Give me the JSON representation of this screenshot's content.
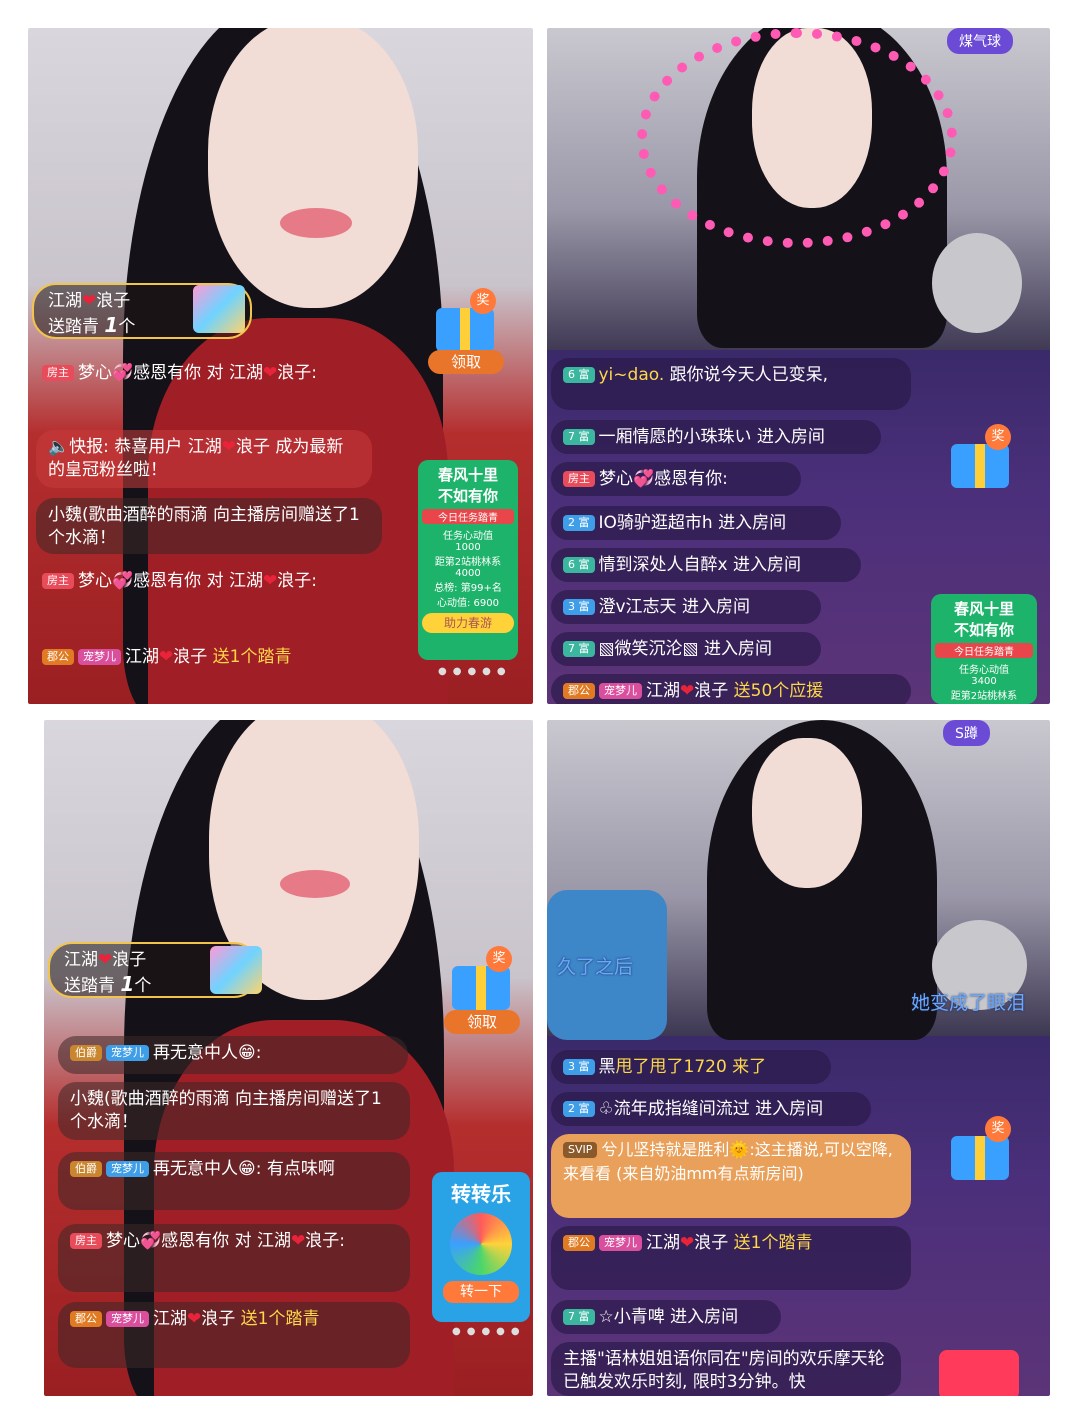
{
  "p1": {
    "gift_card": {
      "name1": "江湖",
      "name2": "浪子",
      "action": "送踏青",
      "count": "1",
      "unit": "个"
    },
    "gift_claim": "领取",
    "gift_badge": "奖",
    "chat": [
      {
        "tag": "房主",
        "user": "梦心",
        "text": "感恩有你 对 江湖",
        "tail": "浪子:"
      },
      {
        "icon": "speaker-icon",
        "text": "快报: 恭喜用户 江湖",
        "tail": "浪子 成为最新的皇冠粉丝啦！"
      },
      {
        "text": "小魏(歌曲酒醉的雨滴 向主播房间赠送了1个水滴！"
      },
      {
        "tag": "房主",
        "user": "梦心",
        "text": "感恩有你 对 江湖",
        "tail": "浪子:"
      },
      {
        "tag1": "郡公",
        "tag2": "宠梦儿",
        "user": "江湖",
        "tail": "浪子",
        "gift": "送1个踏青"
      }
    ],
    "spring": {
      "title1": "春风十里",
      "title2": "不如有你",
      "task": "今日任务踏青",
      "value_label": "任务心动值",
      "value": "1000",
      "gap_label": "距第2站桃林系",
      "gap": "4000",
      "total_label": "总榜: 第99+名",
      "heart_label": "心动值: 6900",
      "button": "助力春游"
    }
  },
  "p2": {
    "top_badge": "煤气球",
    "chat": [
      {
        "tag": "6 富",
        "user": "yi~dao.",
        "text": "跟你说今天人已变呆,"
      },
      {
        "tag": "7 富",
        "user": "一厢情愿的小珠珠い",
        "text": "进入房间"
      },
      {
        "tag": "房主",
        "user": "梦心",
        "text": "感恩有你:"
      },
      {
        "tag": "2 富",
        "user": "IO骑驴逛超市h",
        "text": "进入房间"
      },
      {
        "tag": "6 富",
        "user": "情到深处人自醉x",
        "text": "进入房间"
      },
      {
        "tag": "3 富",
        "user": "澄v江志天",
        "text": "进入房间"
      },
      {
        "tag": "7 富",
        "user": "▧微笑沉沦▧",
        "text": "进入房间"
      },
      {
        "tag1": "郡公",
        "tag2": "宠梦儿",
        "user": "江湖",
        "tail": "浪子",
        "gift": "送50个应援"
      }
    ],
    "gift_badge": "奖",
    "spring": {
      "title1": "春风十里",
      "title2": "不如有你",
      "task": "今日任务踏青",
      "value_label": "任务心动值",
      "value": "3400",
      "gap_label": "距第2站桃林系"
    }
  },
  "p3": {
    "gift_card": {
      "name1": "江湖",
      "name2": "浪子",
      "action": "送踏青",
      "count": "1",
      "unit": "个"
    },
    "gift_claim": "领取",
    "gift_badge": "奖",
    "chat": [
      {
        "tag1": "伯爵",
        "tag2": "宠梦儿",
        "user": "再无意中人",
        "text": ":"
      },
      {
        "text": "小魏(歌曲酒醉的雨滴 向主播房间赠送了1个水滴！"
      },
      {
        "tag1": "伯爵",
        "tag2": "宠梦儿",
        "user": "再无意中人",
        "text": ": 有点味啊"
      },
      {
        "tag": "房主",
        "user": "梦心",
        "text": "感恩有你 对 江湖",
        "tail": "浪子:"
      },
      {
        "tag1": "郡公",
        "tag2": "宠梦儿",
        "user": "江湖",
        "tail": "浪子",
        "gift": "送1个踏青"
      }
    ],
    "wheel": {
      "title": "转转乐",
      "button": "转一下"
    }
  },
  "p4": {
    "top_badge": "S蹲",
    "overlay_left": "久了之后",
    "overlay_right": "她变成了眼泪",
    "chat": [
      {
        "tag": "3 富",
        "user": "黑",
        "text": "甩了甩了1720 来了"
      },
      {
        "tag": "2 富",
        "user": "♧流年成指缝间流过",
        "text": "进入房间"
      },
      {
        "tag": "SVIP",
        "user": "兮儿坚持就是胜利",
        "text": ":这主播说,可以空降,来看看 (来自奶油mm有点新房间)"
      },
      {
        "tag1": "郡公",
        "tag2": "宠梦儿",
        "user": "江湖",
        "tail": "浪子",
        "gift": "送1个踏青"
      },
      {
        "tag": "7 富",
        "user": "☆小青啤",
        "text": "进入房间"
      },
      {
        "text": "主播\"语林姐姐语你同在\"房间的欢乐摩天轮已触发欢乐时刻, 限时3分钟。快"
      }
    ],
    "gift_badge": "奖"
  }
}
